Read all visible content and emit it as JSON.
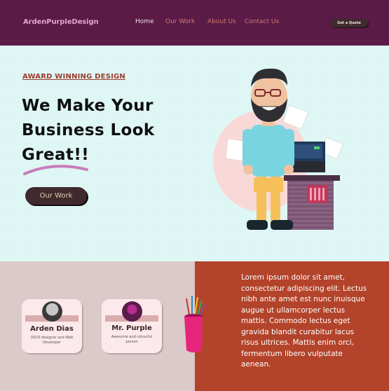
{
  "nav": {
    "brand": "ArdenPurpleDesign",
    "items": [
      "Home",
      "Our Work",
      "About Us",
      "Contact Us"
    ],
    "quote_button": "Get a Quote"
  },
  "hero": {
    "eyebrow": "AWARD WINNING DESIGN",
    "headline": [
      "We Make Your",
      "Business Look",
      "Great!!"
    ],
    "cta": "Our Work"
  },
  "team": [
    {
      "name": "Arden Dias",
      "role": "UX/UI designer and Web Developer"
    },
    {
      "name": "Mr. Purple",
      "role": "Awesome and colourful person"
    }
  ],
  "about": {
    "text": "Lorem ipsum dolor sit amet, consectetur adipiscing elit. Lectus nibh ante amet est nunc inuisque augue ut ullamcorper lectus mattis. Commodo lectus eget gravida blandit curabitur lacus risus ultrices. Mattis enim orci, fermentum libero vulputate aenean."
  },
  "colors": {
    "nav_bg": "#5a1b47",
    "hero_bg": "#dff7f4",
    "accent_dark": "#3f2b2d",
    "panel_left": "#dcc9c9",
    "panel_right": "#b3432a"
  }
}
